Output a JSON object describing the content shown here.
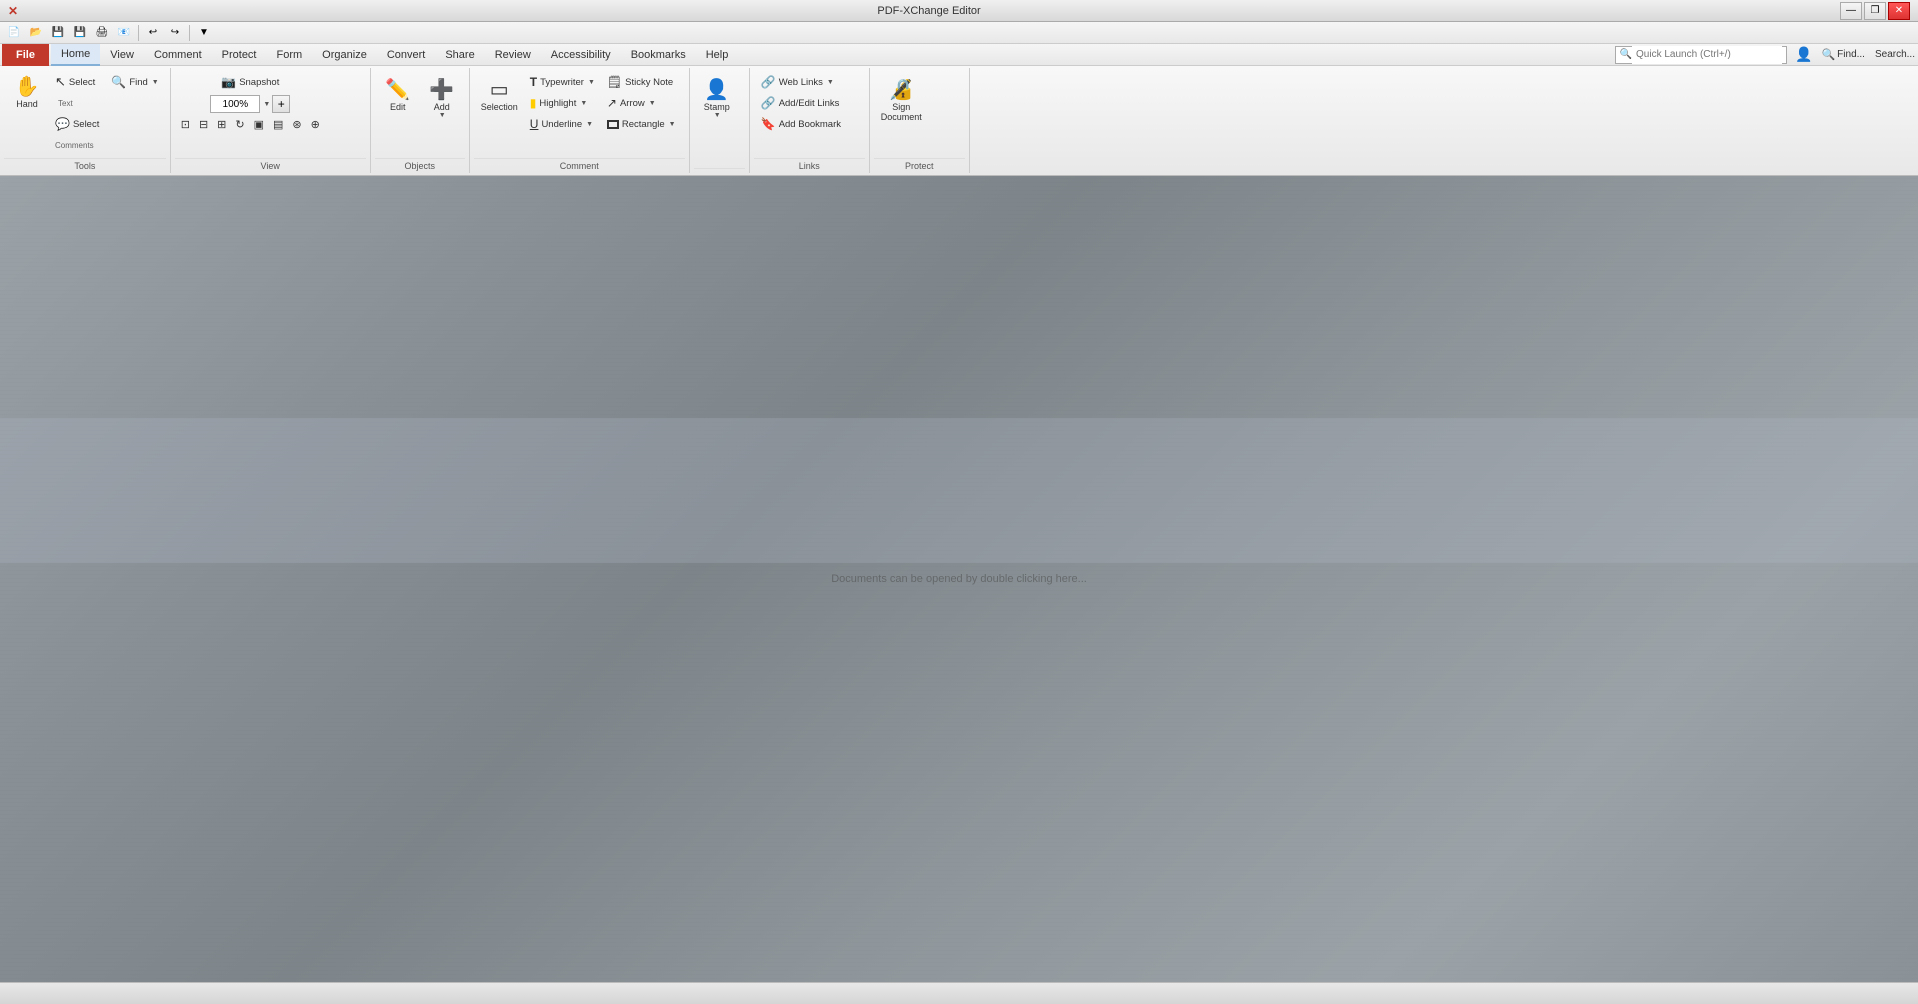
{
  "titlebar": {
    "title": "PDF-XChange Editor",
    "minimize": "—",
    "restore": "❐",
    "close": "✕"
  },
  "quicktoolbar": {
    "buttons": [
      "💾",
      "📂",
      "💾",
      "🖨",
      "📧",
      "↩",
      "↪",
      "✕",
      "✓"
    ]
  },
  "menubar": {
    "file": "File",
    "items": [
      "Home",
      "View",
      "Comment",
      "Protect",
      "Form",
      "Organize",
      "Convert",
      "Share",
      "Review",
      "Accessibility",
      "Bookmarks",
      "Help"
    ],
    "find_label": "Find...",
    "search_label": "Search...",
    "search_placeholder": "Quick Launch (Ctrl+/)"
  },
  "ribbon": {
    "groups": {
      "tools": {
        "label": "Tools",
        "hand": "Hand",
        "select_text": "Select\nText",
        "select_comments": "Select\nComments",
        "find": "Find"
      },
      "view": {
        "label": "View",
        "snapshot": "Snapshot",
        "zoom": "100%",
        "view_btns": [
          "⊡",
          "⊟",
          "⊞",
          "⊡",
          "▣",
          "▤",
          "⊛",
          "⊕"
        ]
      },
      "objects": {
        "label": "Objects",
        "edit": "Edit",
        "add": "Add"
      },
      "comment": {
        "label": "Comment",
        "typewriter": "Typewriter",
        "highlight": "Highlight",
        "underline": "Underline",
        "sticky": "Sticky Note",
        "arrow": "Arrow",
        "rectangle": "Rectangle",
        "selection": "Selection"
      },
      "stamp": {
        "label": "",
        "stamp": "Stamp"
      },
      "links": {
        "label": "Links",
        "web_links": "Web Links",
        "add_edit": "Add/Edit Links",
        "add_bookmark": "Add Bookmark"
      },
      "protect": {
        "label": "Protect",
        "sign": "Sign\nDocument",
        "protect": "Protect"
      }
    }
  },
  "mainarea": {
    "center_text": "Documents can be opened by double clicking here..."
  },
  "statusbar": {
    "text": ""
  }
}
